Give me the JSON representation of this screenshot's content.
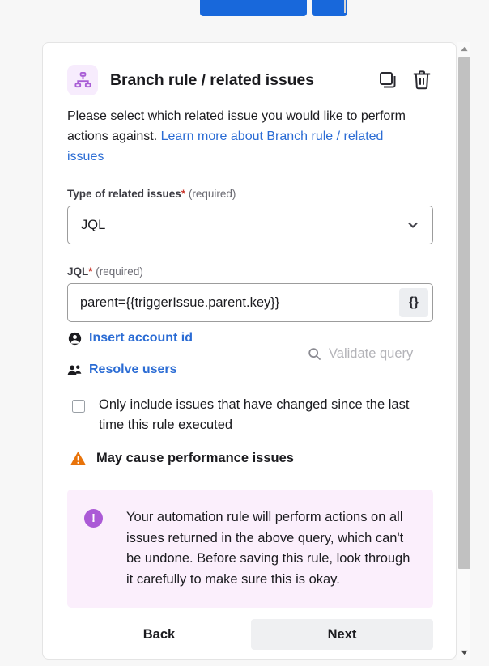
{
  "window": {
    "background_color": "#f7f7f7",
    "top_partial_buttons": {
      "primary_color": "#1868db",
      "secondary_color": "#1868db"
    }
  },
  "card": {
    "header": {
      "icon": "branch-rule-hierarchy-icon",
      "icon_bg_color": "#f7ecfd",
      "icon_color": "#a95ed6",
      "title": "Branch rule / related issues",
      "actions": [
        {
          "name": "duplicate-icon",
          "label": "Duplicate"
        },
        {
          "name": "delete-icon",
          "label": "Delete"
        }
      ]
    },
    "description": {
      "text_before": "Please select which related issue you would like to perform actions against. ",
      "link_text": "Learn more about Branch rule / related issues",
      "link_color": "#2b6cd4"
    },
    "fields": {
      "type_of_related_issues": {
        "label": "Type of related issues",
        "required_star": "*",
        "required_word": "(required)",
        "value": "JQL",
        "chevron_icon": "chevron-down-icon"
      },
      "jql": {
        "label": "JQL",
        "required_star": "*",
        "required_word": "(required)",
        "value": "parent={{triggerIssue.parent.key}}",
        "placeholder": "",
        "smart_values_button_label": "{}"
      }
    },
    "links": {
      "insert_account_id": {
        "label": "Insert account id",
        "icon": "person-icon"
      },
      "resolve_users": {
        "label": "Resolve users",
        "icon": "people-icon"
      },
      "validate_query": {
        "label": "Validate query",
        "icon": "search-icon",
        "disabled": true,
        "color": "#b3b3b8"
      }
    },
    "checkbox": {
      "checked": false,
      "label": "Only include issues that have changed since the last time this rule executed"
    },
    "warning": {
      "icon": "warning-triangle-icon",
      "icon_color": "#e8730a",
      "text": "May cause performance issues"
    },
    "info_panel": {
      "icon": "exclamation-circle-icon",
      "icon_color": "#ab5ad6",
      "background_color": "#fbeffc",
      "text": "Your automation rule will perform actions on all issues returned in the above query, which can't be undone. Before saving this rule, look through it carefully to make sure this is okay."
    },
    "footer": {
      "back_label": "Back",
      "next_label": "Next",
      "next_bg_color": "#eff0f2"
    }
  },
  "scrollbar": {
    "up_arrow": "scroll-up-arrow-icon",
    "down_arrow": "scroll-down-arrow-icon",
    "thumb_color": "#c1c1c1"
  }
}
